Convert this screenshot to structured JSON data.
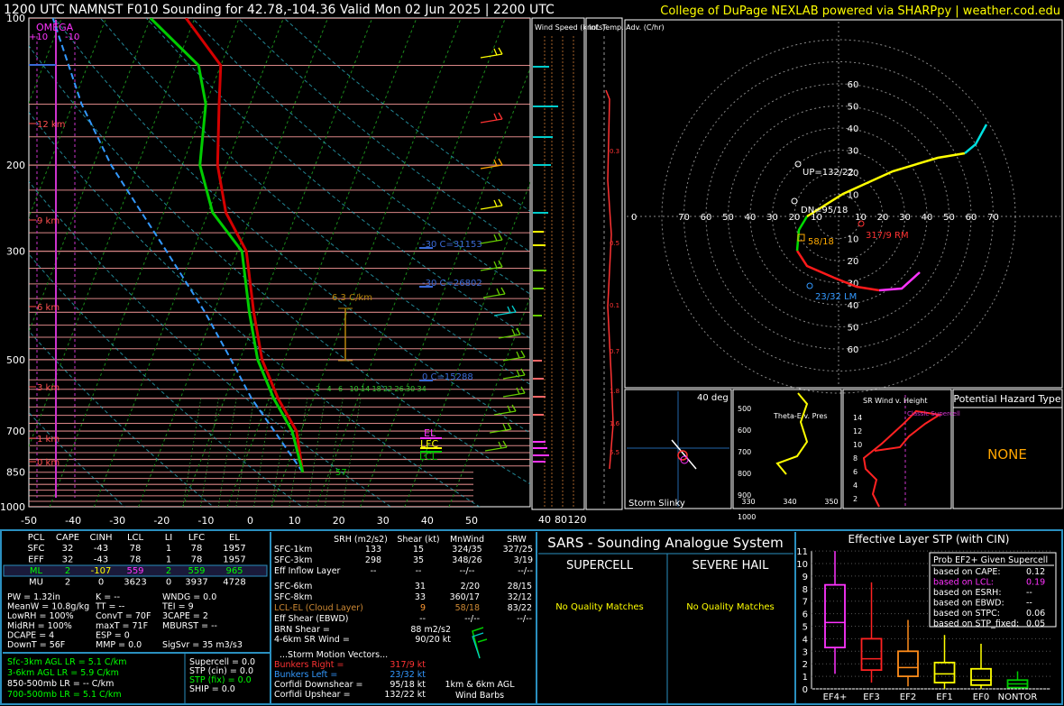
{
  "header": {
    "title": "1200 UTC NAMNST F010 Sounding for 42.78,-104.36 Valid  Mon 02 Jun 2025 | 2200 UTC",
    "credit": "College of DuPage NEXLAB powered via SHARPpy | weather.cod.edu"
  },
  "colors": {
    "temp": "#d40000",
    "dew": "#00cc00",
    "parcel": "#3399ff",
    "cyan": "#00d0d0",
    "yellow": "#ffff00",
    "magenta": "#ff33ff",
    "frame": "#2a8fbf",
    "orange": "#ffa500"
  },
  "skewt": {
    "omega_label": "OMEGA",
    "omega_left": "+10",
    "omega_right": "-10",
    "pressure_ticks": [
      "100",
      "200",
      "300",
      "500",
      "700",
      "850",
      "1000"
    ],
    "temp_ticks": [
      "-50",
      "-40",
      "-30",
      "-20",
      "-10",
      "0",
      "10",
      "20",
      "30",
      "40",
      "50"
    ],
    "heights": [
      "12 km",
      "9 km",
      "6 km",
      "3 km",
      "1 km",
      "0 km"
    ],
    "annotations": {
      "lapse": "6.3 C/km",
      "isotherm_m30_a": "-30 C=31153",
      "isotherm_m30_b": "-30 C=26802",
      "isotherm_0": "0 C=15288",
      "el": "EL",
      "lfc": "LFC",
      "lcl": "LCL",
      "sfc_dew": "57",
      "mixing": [
        "2",
        "4",
        "6",
        "10",
        "14",
        "18",
        "22",
        "26",
        "30",
        "34"
      ]
    }
  },
  "side": {
    "wind_speed_label": "Wind Speed (knots)",
    "wind_ticks": [
      "40",
      "80",
      "120"
    ],
    "inf_label": "Inf. Temp. Adv. (C/hr)",
    "inf_values": [
      "0.3",
      "0.5",
      "0.1",
      "0.7",
      "1.8",
      "1.6",
      "5.5"
    ]
  },
  "hodograph": {
    "rings": [
      "10",
      "20",
      "30",
      "40",
      "50",
      "60",
      "70"
    ],
    "up": "UP=132/22",
    "dn": "DN=95/18",
    "rm": "317/9 RM",
    "lm": "23/32 LM",
    "mean": "58/18"
  },
  "slinky": {
    "deg": "40 deg",
    "label": "Storm Slinky"
  },
  "theta": {
    "ticks": [
      "500",
      "600",
      "700",
      "800",
      "900",
      "1000"
    ],
    "xticks": [
      "330",
      "340",
      "350"
    ],
    "label": "Theta-E v. Pres"
  },
  "srwind": {
    "label": "SR Wind v. Height",
    "ticks": [
      "14",
      "12",
      "10",
      "8",
      "6",
      "4",
      "2"
    ],
    "classic": "Classic Supercell"
  },
  "hazard": {
    "title": "Potential Hazard Type",
    "value": "NONE"
  },
  "parcels": {
    "headers": [
      "PCL",
      "CAPE",
      "CINH",
      "LCL",
      "LI",
      "LFC",
      "EL"
    ],
    "rows": [
      [
        "SFC",
        "32",
        "-43",
        "78",
        "1",
        "78",
        "1957"
      ],
      [
        "EFF",
        "32",
        "-43",
        "78",
        "1",
        "78",
        "1957"
      ],
      [
        "ML",
        "2",
        "-107",
        "559",
        "2",
        "559",
        "965"
      ],
      [
        "MU",
        "2",
        "0",
        "3623",
        "0",
        "3937",
        "4728"
      ]
    ]
  },
  "indices": {
    "col1": [
      "PW = 1.32in",
      "MeanW = 10.8g/kg",
      "LowRH = 100%",
      "MidRH = 100%",
      "DCAPE = 4",
      "DownT = 56F"
    ],
    "col2": [
      "K = --",
      "TT = --",
      "ConvT = 70F",
      "maxT = 71F",
      "ESP = 0",
      "MMP = 0.0"
    ],
    "col3": [
      "WNDG = 0.0",
      "TEI = 9",
      "3CAPE = 2",
      "MBURST = --",
      "",
      "SigSvr = 35 m3/s3"
    ]
  },
  "lapse_rates": [
    "Sfc-3km AGL LR = 5.1 C/km",
    "3-6km AGL LR = 5.9 C/km",
    "850-500mb LR = -- C/km",
    "700-500mb LR = 5.1 C/km"
  ],
  "composites": [
    "Supercell = 0.0",
    "STP (cin) = 0.0",
    "STP (fix) = 0.0",
    "SHIP = 0.0"
  ],
  "kinematics": {
    "headers": [
      "SRH (m2/s2)",
      "Shear (kt)",
      "MnWind",
      "SRW"
    ],
    "rows": [
      [
        "SFC-1km",
        "133",
        "15",
        "324/35",
        "327/25"
      ],
      [
        "SFC-3km",
        "298",
        "35",
        "348/26",
        "3/19"
      ],
      [
        "Eff Inflow Layer",
        "--",
        "--",
        "--/--",
        "--/--"
      ],
      [
        "",
        "",
        "",
        "",
        ""
      ],
      [
        "SFC-6km",
        "31",
        "2/20",
        "28/15",
        ""
      ],
      [
        "SFC-8km",
        "33",
        "360/17",
        "32/12",
        ""
      ],
      [
        "LCL-EL (Cloud Layer)",
        "9",
        "58/18",
        "83/22",
        ""
      ],
      [
        "Eff Shear (EBWD)",
        "--",
        "--/--",
        "--/--",
        ""
      ]
    ],
    "brn": "BRN Shear =",
    "brn_val": "88 m2/s2",
    "sr46": "4-6km SR Wind =",
    "sr46_val": "90/20 kt",
    "storm_title": "...Storm Motion Vectors...",
    "br": "Bunkers Right =",
    "br_val": "317/9 kt",
    "bl": "Bunkers Left =",
    "bl_val": "23/32 kt",
    "cd": "Corfidi Downshear =",
    "cd_val": "95/18 kt",
    "cu": "Corfidi Upshear =",
    "cu_val": "132/22 kt",
    "barb_label1": "1km & 6km AGL",
    "barb_label2": "Wind Barbs"
  },
  "sars": {
    "title": "SARS - Sounding Analogue System",
    "supercell": "SUPERCELL",
    "hail": "SEVERE HAIL",
    "no_match": "No Quality Matches"
  },
  "stp": {
    "title": "Effective Layer STP (with CIN)",
    "prob_title": "Prob EF2+ Given Supercell",
    "probs": [
      [
        "based on CAPE:",
        "0.12"
      ],
      [
        "based on LCL:",
        "0.19"
      ],
      [
        "based on ESRH:",
        "--"
      ],
      [
        "based on EBWD:",
        "--"
      ],
      [
        "based on STPC:",
        "0.06"
      ],
      [
        "based on STP_fixed:",
        "0.05"
      ]
    ],
    "yticks": [
      "0",
      "1",
      "2",
      "3",
      "4",
      "5",
      "6",
      "7",
      "8",
      "9",
      "10",
      "11"
    ],
    "categories": [
      "EF4+",
      "EF3",
      "EF2",
      "EF1",
      "EF0",
      "NONTOR"
    ]
  },
  "chart_data": [
    {
      "type": "line",
      "title": "1200 UTC NAMNST F010 Sounding for 42.78,-104.36 Valid  Mon 02 Jun 2025 | 2200 UTC",
      "xlabel": "",
      "ylabel": "",
      "xlim": [
        -50,
        50
      ],
      "ylim": [
        1000,
        100
      ],
      "y_scale": "log-pressure",
      "grid": true,
      "series": [
        {
          "name": "",
          "x_temp_c": [
            14,
            9,
            2,
            -5,
            -11,
            -18,
            -26,
            -32,
            -37,
            -40,
            -52
          ],
          "pressure_mb": [
            850,
            700,
            600,
            500,
            400,
            300,
            250,
            200,
            150,
            125,
            100
          ]
        },
        {
          "name": "",
          "x_temp_c": [
            14,
            8,
            1,
            -6,
            -12,
            -19,
            -29,
            -36,
            -40,
            -45,
            -60
          ],
          "pressure_mb": [
            850,
            700,
            600,
            500,
            400,
            300,
            250,
            200,
            150,
            125,
            100
          ]
        }
      ]
    },
    {
      "type": "box",
      "title": "Effective Layer STP (with CIN)",
      "categories": [
        "EF4+",
        "EF3",
        "EF2",
        "EF1",
        "EF0",
        "NONTOR"
      ],
      "ylim": [
        0,
        11
      ],
      "boxes": [
        {
          "whisker_low": 1.2,
          "q1": 3.3,
          "median": 5.3,
          "q3": 8.3,
          "whisker_high": 11.0
        },
        {
          "whisker_low": 0.5,
          "q1": 1.5,
          "median": 2.4,
          "q3": 4.0,
          "whisker_high": 8.5
        },
        {
          "whisker_low": 0.2,
          "q1": 1.0,
          "median": 1.7,
          "q3": 3.0,
          "whisker_high": 5.5
        },
        {
          "whisker_low": 0.0,
          "q1": 0.5,
          "median": 1.2,
          "q3": 2.1,
          "whisker_high": 4.3
        },
        {
          "whisker_low": 0.0,
          "q1": 0.3,
          "median": 0.7,
          "q3": 1.6,
          "whisker_high": 3.6
        },
        {
          "whisker_low": 0.0,
          "q1": 0.1,
          "median": 0.4,
          "q3": 0.7,
          "whisker_high": 1.4
        }
      ]
    }
  ]
}
